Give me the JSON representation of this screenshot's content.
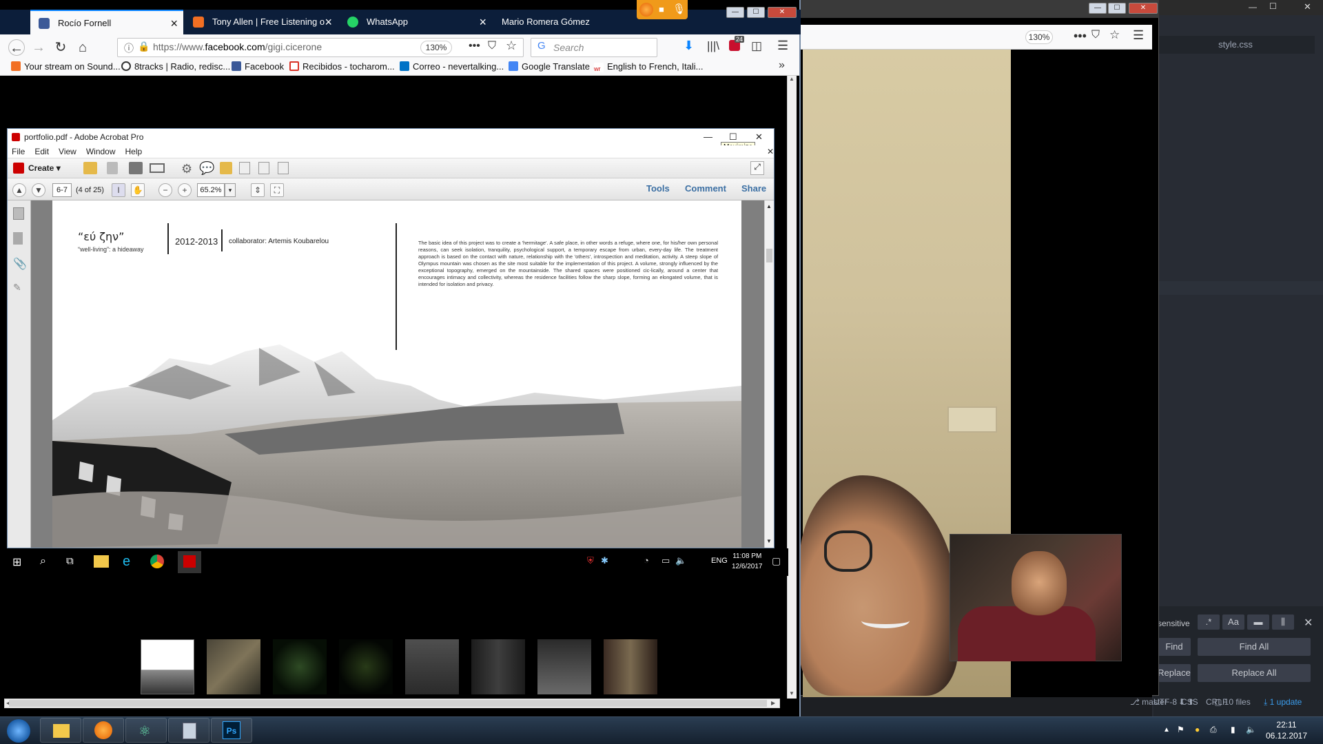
{
  "atom": {
    "tab_title": "style.css",
    "find": {
      "case_sensitive_label": "sensitive",
      "find_btn": "Find",
      "find_all_btn": "Find All",
      "replace_btn": "Replace",
      "replace_all_btn": "Replace All"
    },
    "status": {
      "line_ending": "CRLF",
      "encoding": "UTF-8",
      "grammar": "CSS",
      "branch": "master",
      "files": "10 files",
      "updates": "1 update"
    }
  },
  "taskbar": {
    "time": "22:11",
    "date": "06.12.2017"
  },
  "firefox": {
    "tabs": [
      {
        "label": "Rocío Fornell",
        "close": "×"
      },
      {
        "label": "Tony Allen | Free Listening o",
        "close": "×"
      },
      {
        "label": "WhatsApp",
        "close": "×"
      },
      {
        "label": "Mario Romera Gómez",
        "close": ""
      }
    ],
    "url": {
      "prefix": "https://www.",
      "domain": "facebook.com",
      "path": "/gigi.cicerone"
    },
    "zoom": "130%",
    "search_placeholder": "Search",
    "notification_count": "24",
    "bookmarks": [
      "Your stream on Sound...",
      "8tracks | Radio, redisc...",
      "Facebook",
      "Recibidos - tocharom...",
      "Correo - nevertalking...",
      "Google Translate",
      "English to French, Itali..."
    ],
    "window_controls": {
      "min": "—",
      "max": "☐",
      "close": "✕"
    }
  },
  "firefox2": {
    "zoom": "130%",
    "window_controls": {
      "min": "—",
      "max": "☐",
      "close": "✕"
    }
  },
  "acrobat": {
    "title": "portfolio.pdf - Adobe Acrobat Pro",
    "menu": [
      "File",
      "Edit",
      "View",
      "Window",
      "Help"
    ],
    "create_label": "Create",
    "page_input": "6-7",
    "page_count": "(4 of 25)",
    "zoom_value": "65.2%",
    "links": {
      "tools": "Tools",
      "comment": "Comment",
      "share": "Share"
    },
    "tooltip": "Maximize",
    "page": {
      "title": "“εύ ζην”",
      "subtitle": "“well-living”: a hideaway",
      "year": "2012-2013",
      "collaborator": "collaborator: Artemis Koubarelou",
      "body": "The basic idea of this project was to create a 'hermitage'. A safe place, in other words a refuge, where one, for his/her own personal reasons, can seek isolation, tranquility, psychological support, a temporary escape from urban, every-day life. The treatment approach is based on the contact with nature, relationship with the 'others', introspection and meditation, activity. A steep slope of Olympus mountain was chosen as the site most suitable for the implementation of this project. A volume, strongly influenced by the exceptional topography, emerged on the mountainside. The shared spaces were positioned cic-lically, around a center that encourages intimacy and collectivity, whereas the residence facilities follow the sharp slope, forming an elongated volume, that is intended for isolation and privacy."
    }
  },
  "win10": {
    "lang": "ENG",
    "time": "11:08 PM",
    "date": "12/6/2017"
  }
}
